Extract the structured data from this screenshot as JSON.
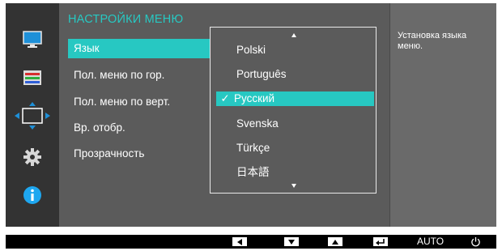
{
  "menu": {
    "title": "НАСТРОЙКИ МЕНЮ",
    "items": [
      {
        "label": "Язык",
        "selected": true
      },
      {
        "label": "Пол. меню по гор.",
        "selected": false
      },
      {
        "label": "Пол. меню по верт.",
        "selected": false
      },
      {
        "label": "Вр. отобр.",
        "selected": false
      },
      {
        "label": "Прозрачность",
        "selected": false
      }
    ]
  },
  "language_list": {
    "options": [
      "Polski",
      "Português",
      "Русский",
      "Svenska",
      "Türkçe",
      "日本語"
    ],
    "selected": "Русский",
    "check_glyph": "✓"
  },
  "help": {
    "text": "Установка языка меню."
  },
  "sidebar": {
    "icons": [
      "monitor-icon",
      "color-icon",
      "size-position-icon",
      "settings-gear-icon",
      "info-icon"
    ]
  },
  "bottom_bar": {
    "buttons": [
      "left-arrow-button",
      "down-arrow-button",
      "up-arrow-button",
      "enter-button"
    ],
    "auto_label": "AUTO"
  },
  "colors": {
    "accent": "#27c8c2",
    "panel": "#5b5b5b",
    "sidebar": "#333333",
    "info_blue": "#1ea7f0"
  }
}
